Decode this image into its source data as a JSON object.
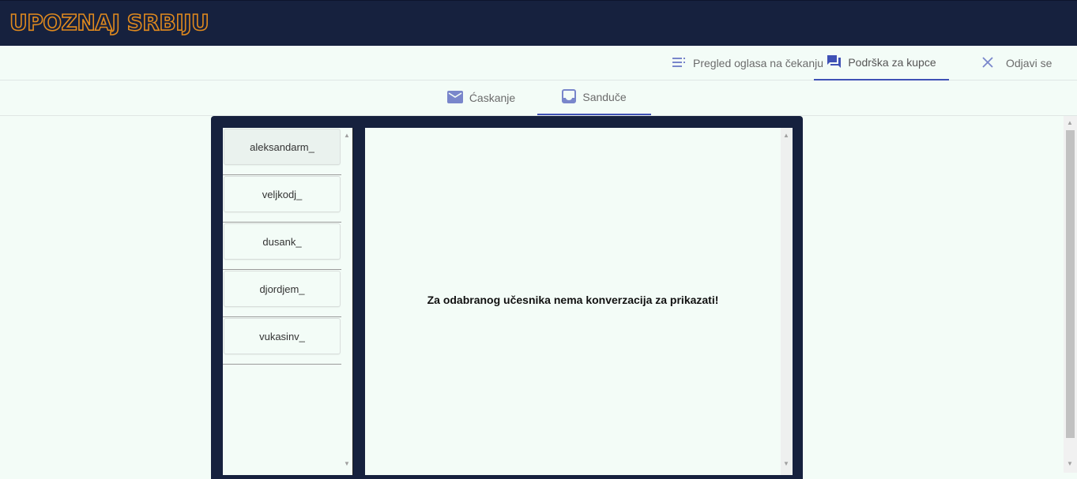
{
  "brand": {
    "logo_text": "UPOZNAJ SRBIJU",
    "accent": "#e08a1e",
    "bg": "#16213e"
  },
  "nav": {
    "items": [
      {
        "label": "Pregled oglasa na čekanju",
        "icon": "list-icon"
      },
      {
        "label": "Podrška za kupce",
        "icon": "forum-icon",
        "active": true
      },
      {
        "label": "Odjavi se",
        "icon": "close-icon"
      }
    ]
  },
  "tabs": [
    {
      "label": "Ćaskanje",
      "icon": "mail-icon"
    },
    {
      "label": "Sandučе",
      "icon": "inbox-icon",
      "active": true
    }
  ],
  "users": [
    "aleksandarm_",
    "veljkodj_",
    "dusank_",
    "djordjem_",
    "vukasinv_"
  ],
  "conversation": {
    "empty_message": "Za odabranog učesnika nema konverzacija za prikazati!"
  }
}
